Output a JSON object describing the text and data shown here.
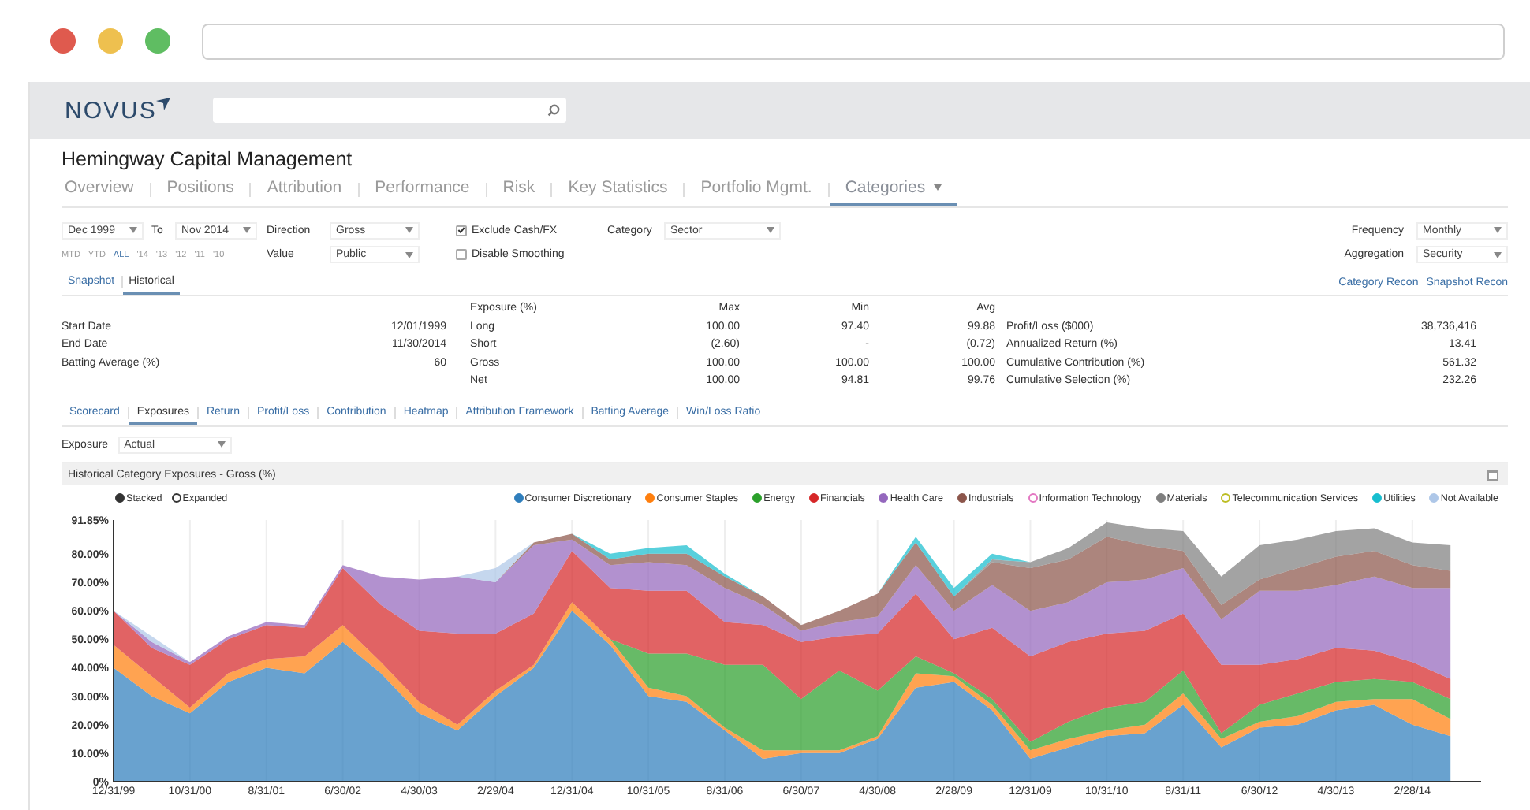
{
  "header": {
    "logo": "NOVUS"
  },
  "title": "Hemingway Capital Management",
  "nav_tabs": [
    {
      "label": "Overview",
      "selected": false
    },
    {
      "label": "Positions",
      "selected": false
    },
    {
      "label": "Attribution",
      "selected": false
    },
    {
      "label": "Performance",
      "selected": false
    },
    {
      "label": "Risk",
      "selected": false
    },
    {
      "label": "Key Statistics",
      "selected": false
    },
    {
      "label": "Portfolio Mgmt.",
      "selected": false
    },
    {
      "label": "Categories",
      "selected": true,
      "dropdown": true
    }
  ],
  "filters": {
    "from": "Dec 1999",
    "to_label": "To",
    "to": "Nov 2014",
    "quick_ranges": [
      {
        "label": "MTD",
        "selected": false
      },
      {
        "label": "YTD",
        "selected": false
      },
      {
        "label": "ALL",
        "selected": true
      },
      {
        "label": "'14",
        "selected": false
      },
      {
        "label": "'13",
        "selected": false
      },
      {
        "label": "'12",
        "selected": false
      },
      {
        "label": "'11",
        "selected": false
      },
      {
        "label": "'10",
        "selected": false
      }
    ],
    "direction_label": "Direction",
    "direction": "Gross",
    "value_label": "Value",
    "value": "Public",
    "checkboxes": [
      {
        "label": "Exclude Cash/FX",
        "checked": true
      },
      {
        "label": "Disable Smoothing",
        "checked": false
      }
    ],
    "category_label": "Category",
    "category": "Sector",
    "frequency_label": "Frequency",
    "frequency": "Monthly",
    "aggregation_label": "Aggregation",
    "aggregation": "Security"
  },
  "view_tabs": [
    {
      "label": "Snapshot",
      "selected": false
    },
    {
      "label": "Historical",
      "selected": true
    }
  ],
  "links": [
    "Category Recon",
    "Snapshot Recon"
  ],
  "summary": [
    {
      "label": "Start Date",
      "value": "12/01/1999"
    },
    {
      "label": "End Date",
      "value": "11/30/2014"
    },
    {
      "label": "Batting Average (%)",
      "value": "60"
    }
  ],
  "exposure_table": {
    "columns": [
      "Exposure (%)",
      "Max",
      "Min",
      "Avg"
    ],
    "rows": [
      {
        "label": "Long",
        "max": "100.00",
        "min": "97.40",
        "avg": "99.88"
      },
      {
        "label": "Short",
        "max": "(2.60)",
        "min": "-",
        "avg": "(0.72)"
      },
      {
        "label": "Gross",
        "max": "100.00",
        "min": "100.00",
        "avg": "100.00"
      },
      {
        "label": "Net",
        "max": "100.00",
        "min": "94.81",
        "avg": "99.76"
      }
    ]
  },
  "performance": [
    {
      "label": "Profit/Loss ($000)",
      "value": "38,736,416"
    },
    {
      "label": "Annualized Return (%)",
      "value": "13.41"
    },
    {
      "label": "Cumulative Contribution (%)",
      "value": "561.32"
    },
    {
      "label": "Cumulative Selection (%)",
      "value": "232.26"
    }
  ],
  "analysis_tabs": [
    {
      "label": "Scorecard",
      "selected": false
    },
    {
      "label": "Exposures",
      "selected": true
    },
    {
      "label": "Return",
      "selected": false
    },
    {
      "label": "Profit/Loss",
      "selected": false
    },
    {
      "label": "Contribution",
      "selected": false
    },
    {
      "label": "Heatmap",
      "selected": false
    },
    {
      "label": "Attribution Framework",
      "selected": false
    },
    {
      "label": "Batting Average",
      "selected": false
    },
    {
      "label": "Win/Loss Ratio",
      "selected": false
    }
  ],
  "exposure_select": {
    "label": "Exposure",
    "value": "Actual"
  },
  "chart_panel": {
    "title": "Historical Category Exposures - Gross (%)",
    "modes": [
      {
        "label": "Stacked",
        "selected": true
      },
      {
        "label": "Expanded",
        "selected": false
      }
    ],
    "chart_data": {
      "type": "area",
      "stacked": true,
      "grid": true,
      "ylim": [
        0,
        91.85
      ],
      "categories": [
        "12/31/99",
        null,
        "10/31/00",
        null,
        "8/31/01",
        null,
        "6/30/02",
        null,
        "4/30/03",
        null,
        "2/29/04",
        null,
        "12/31/04",
        null,
        "10/31/05",
        null,
        "8/31/06",
        null,
        "6/30/07",
        null,
        "4/30/08",
        null,
        "2/28/09",
        null,
        "12/31/09",
        null,
        "10/31/10",
        null,
        "8/31/11",
        null,
        "6/30/12",
        null,
        "4/30/13",
        null,
        "2/28/14",
        null
      ],
      "yticks": [
        {
          "value": 0,
          "label": "0%"
        },
        {
          "value": 10,
          "label": "10.00%"
        },
        {
          "value": 20,
          "label": "20.00%"
        },
        {
          "value": 30,
          "label": "30.00%"
        },
        {
          "value": 40,
          "label": "40.00%"
        },
        {
          "value": 50,
          "label": "50.00%"
        },
        {
          "value": 60,
          "label": "60.00%"
        },
        {
          "value": 70,
          "label": "70.00%"
        },
        {
          "value": 80,
          "label": "80.00%"
        },
        {
          "value": 91.85,
          "label": "91.85%"
        }
      ],
      "series": [
        {
          "name": "Consumer Discretionary",
          "color": "#2f7ebc",
          "values": [
            40,
            30,
            24,
            35,
            40,
            38,
            49,
            38,
            24,
            18,
            30,
            40,
            60,
            48,
            30,
            28,
            18,
            8,
            10,
            10,
            15,
            33,
            35,
            25,
            8,
            12,
            16,
            17,
            27,
            12,
            19,
            20,
            25,
            27,
            20,
            16
          ]
        },
        {
          "name": "Consumer Staples",
          "color": "#ff7f0e",
          "values": [
            8,
            7,
            2,
            3,
            3,
            6,
            6,
            4,
            4,
            2,
            2,
            1,
            3,
            2,
            3,
            2,
            1,
            3,
            1,
            1,
            1,
            5,
            2,
            2,
            3,
            3,
            2,
            3,
            4,
            3,
            2,
            3,
            3,
            2,
            9,
            6
          ]
        },
        {
          "name": "Energy",
          "color": "#2ca02c",
          "values": [
            0,
            0,
            0,
            0,
            0,
            0,
            0,
            0,
            0,
            0,
            0,
            0,
            0,
            0,
            12,
            15,
            22,
            30,
            18,
            28,
            16,
            6,
            1,
            2,
            3,
            6,
            8,
            8,
            8,
            2,
            6,
            8,
            7,
            7,
            6,
            7
          ]
        },
        {
          "name": "Financials",
          "color": "#d62728",
          "values": [
            12,
            10,
            15,
            12,
            12,
            10,
            20,
            20,
            25,
            32,
            20,
            18,
            18,
            18,
            22,
            22,
            15,
            14,
            20,
            12,
            20,
            22,
            12,
            25,
            30,
            28,
            26,
            25,
            20,
            24,
            14,
            12,
            12,
            10,
            7,
            7
          ]
        },
        {
          "name": "Health Care",
          "color": "#9467bd",
          "values": [
            0,
            2,
            1,
            1,
            1,
            1,
            1,
            10,
            18,
            20,
            18,
            24,
            4,
            8,
            10,
            9,
            12,
            7,
            4,
            5,
            6,
            10,
            10,
            15,
            16,
            14,
            18,
            18,
            16,
            16,
            26,
            24,
            22,
            26,
            26,
            32
          ]
        },
        {
          "name": "Industrials",
          "color": "#8c564b",
          "values": [
            0,
            0,
            0,
            0,
            0,
            0,
            0,
            0,
            0,
            0,
            0,
            1,
            2,
            2,
            3,
            4,
            4,
            3,
            2,
            4,
            8,
            8,
            5,
            8,
            15,
            15,
            16,
            12,
            6,
            5,
            4,
            8,
            10,
            9,
            8,
            6
          ]
        },
        {
          "name": "Information Technology",
          "color": "#e377c2",
          "values": [
            null,
            null,
            null,
            null,
            null,
            null,
            null,
            null,
            null,
            null,
            null,
            null,
            null,
            null,
            null,
            null,
            null,
            null,
            null,
            null,
            null,
            null,
            null,
            null,
            null,
            null,
            null,
            null,
            null,
            null,
            null,
            null,
            null,
            null,
            null,
            null
          ]
        },
        {
          "name": "Materials",
          "color": "#7f7f7f",
          "values": [
            0,
            0,
            0,
            0,
            0,
            0,
            0,
            0,
            0,
            0,
            0,
            0,
            0,
            0,
            0,
            0,
            0,
            0,
            0,
            0,
            0,
            0,
            0,
            1,
            2,
            4,
            5,
            6,
            7,
            10,
            12,
            10,
            9,
            8,
            8,
            9
          ]
        },
        {
          "name": "Telecommunication Services",
          "color": "#bcbd22",
          "values": [
            null,
            null,
            null,
            null,
            null,
            null,
            null,
            null,
            null,
            null,
            null,
            null,
            null,
            null,
            null,
            null,
            null,
            null,
            null,
            null,
            null,
            null,
            null,
            null,
            null,
            null,
            null,
            null,
            null,
            null,
            null,
            null,
            null,
            null,
            null,
            null
          ]
        },
        {
          "name": "Utilities",
          "color": "#17becf",
          "values": [
            null,
            null,
            null,
            null,
            null,
            null,
            null,
            null,
            null,
            null,
            null,
            null,
            0,
            2,
            2,
            3,
            1,
            0,
            null,
            null,
            0,
            2,
            3,
            2,
            0,
            null,
            null,
            null,
            null,
            null,
            null,
            null,
            null,
            null,
            null,
            null
          ]
        },
        {
          "name": "Not Available",
          "color": "#aec7e8",
          "values": [
            0,
            2,
            0,
            null,
            null,
            null,
            null,
            null,
            null,
            0,
            5,
            0,
            null,
            null,
            null,
            null,
            null,
            null,
            null,
            null,
            null,
            null,
            null,
            null,
            null,
            null,
            null,
            null,
            null,
            null,
            null,
            null,
            null,
            null,
            null,
            null
          ]
        }
      ]
    }
  }
}
